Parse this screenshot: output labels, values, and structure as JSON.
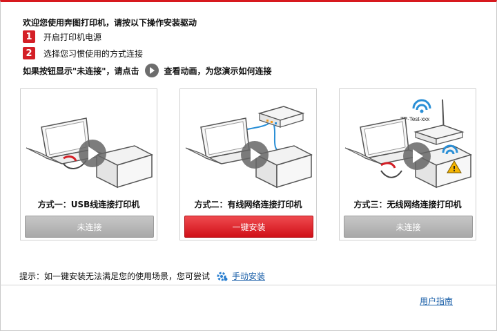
{
  "title": "欢迎您使用奔图打印机，请按以下操作安装驱动",
  "steps": [
    {
      "num": "1",
      "text": "开启打印机电源"
    },
    {
      "num": "2",
      "text": "选择您习惯使用的方式连接"
    }
  ],
  "hint": {
    "before": "如果按钮显示\"未连接\"，请点击",
    "after": "查看动画，为您演示如何连接"
  },
  "cards": [
    {
      "label": "方式一：USB线连接打印机",
      "button": "未连接",
      "button_state": "disabled"
    },
    {
      "label": "方式二：有线网络连接打印机",
      "button": "一键安装",
      "button_state": "active"
    },
    {
      "label": "方式三：无线网络连接打印机",
      "button": "未连接",
      "button_state": "disabled",
      "ssid": "TP-Test-xxx"
    }
  ],
  "tip": {
    "text": "提示：如一键安装无法满足您的使用场景，您可尝试",
    "link": "手动安装"
  },
  "footer_link": "用户指南",
  "colors": {
    "brand_red": "#d41f26",
    "link_blue": "#1a5fa8",
    "disabled_gray": "#b5b5b5"
  }
}
